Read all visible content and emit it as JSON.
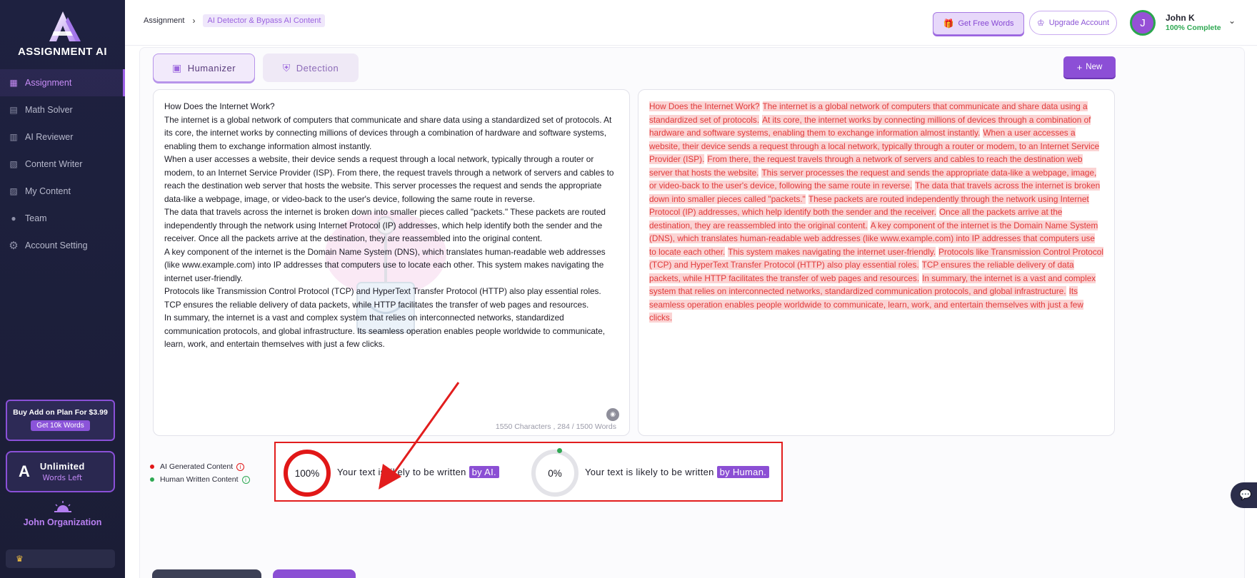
{
  "sidebar": {
    "logo_text": "ASSIGNMENT AI",
    "items": [
      {
        "label": "Assignment",
        "icon": "assignment-icon",
        "active": true
      },
      {
        "label": "Math Solver",
        "icon": "calculator-icon"
      },
      {
        "label": "AI Reviewer",
        "icon": "document-icon"
      },
      {
        "label": "Content Writer",
        "icon": "clipboard-icon"
      },
      {
        "label": "My Content",
        "icon": "folder-icon"
      },
      {
        "label": "Team",
        "icon": "team-icon"
      },
      {
        "label": "Account Setting",
        "icon": "gear-icon"
      }
    ],
    "promo": {
      "title": "Buy Add on Plan For $3.99",
      "button": "Get 10k Words"
    },
    "unlimited": {
      "title": "Unlimited",
      "subtitle": "Words Left"
    },
    "org_name": "John Organization"
  },
  "header": {
    "breadcrumb": [
      "Assignment",
      "AI Detector & Bypass AI Content"
    ],
    "free_words": "Get Free Words",
    "upgrade": "Upgrade Account",
    "avatar_initial": "J",
    "user_name": "John K",
    "user_status": "100% Complete"
  },
  "tabs": {
    "humanizer": "Humanizer",
    "detection": "Detection"
  },
  "new_button": "New",
  "editor": {
    "paragraphs": [
      "How Does the Internet Work?",
      "The internet is a global network of computers that communicate and share data using a standardized set of protocols. At its core, the internet works by connecting millions of devices through a combination of hardware and software systems, enabling them to exchange information almost instantly.",
      "When a user accesses a website, their device sends a request through a local network, typically through a router or modem, to an Internet Service Provider (ISP). From there, the request travels through a network of servers and cables to reach the destination web server that hosts the website. This server processes the request and sends the appropriate data-like a webpage, image, or video-back to the user's device, following the same route in reverse.",
      "The data that travels across the internet is broken down into smaller pieces called \"packets.\" These packets are routed independently through the network using Internet Protocol (IP) addresses, which help identify both the sender and the receiver. Once all the packets arrive at the destination, they are reassembled into the original content.",
      "A key component of the internet is the Domain Name System (DNS), which translates human-readable web addresses (like www.example.com) into IP addresses that computers use to locate each other. This system makes navigating the internet user-friendly.",
      "Protocols like Transmission Control Protocol (TCP) and HyperText Transfer Protocol (HTTP) also play essential roles. TCP ensures the reliable delivery of data packets, while HTTP facilitates the transfer of web pages and resources.",
      "In summary, the internet is a vast and complex system that relies on interconnected networks, standardized communication protocols, and global infrastructure. Its seamless operation enables people worldwide to communicate, learn, work, and entertain themselves with just a few clicks."
    ],
    "char_count": "1550 Characters , 284 / 1500 Words"
  },
  "output": {
    "segments": [
      "How Does the Internet Work?",
      "The internet is a global network of computers that communicate and share data using a standardized set of protocols.",
      "At its core, the internet works by connecting millions of devices through a combination of hardware and software systems, enabling them to exchange information almost instantly.",
      "When a user accesses a website, their device sends a request through a local network, typically through a router or modem, to an Internet Service Provider (ISP).",
      "From there, the request travels through a network of servers and cables to reach the destination web server that hosts the website.",
      "This server processes the request and sends the appropriate data-like a webpage, image, or video-back to the user's device, following the same route in reverse.",
      "The data that travels across the internet is broken down into smaller pieces called \"packets.\"",
      "These packets are routed independently through the network using Internet Protocol (IP) addresses, which help identify both the sender and the receiver.",
      "Once all the packets arrive at the destination, they are reassembled into the original content.",
      "A key component of the internet is the Domain Name System (DNS), which translates human-readable web addresses (like www.example.com) into IP addresses that computers use to locate each other.",
      "This system makes navigating the internet user-friendly.",
      "Protocols like Transmission Control Protocol (TCP) and HyperText Transfer Protocol (HTTP) also play essential roles.",
      "TCP ensures the reliable delivery of data packets, while HTTP facilitates the transfer of web pages and resources.",
      "In summary, the internet is a vast and complex system that relies on interconnected networks, standardized communication protocols, and global infrastructure.",
      "Its seamless operation enables people worldwide to communicate, learn, work, and entertain themselves with just a few clicks."
    ]
  },
  "legend": {
    "ai": "AI Generated Content",
    "human": "Human Written Content"
  },
  "results": {
    "ai_percent": "100%",
    "ai_text": "Your text is likely to be written",
    "ai_badge": "by AI.",
    "human_percent": "0%",
    "human_text": "Your text is likely to be written",
    "human_badge": "by Human."
  },
  "colors": {
    "accent": "#8b4fd4",
    "ai": "#e11717",
    "human": "#2ea852",
    "sidebar": "#1e2140"
  }
}
